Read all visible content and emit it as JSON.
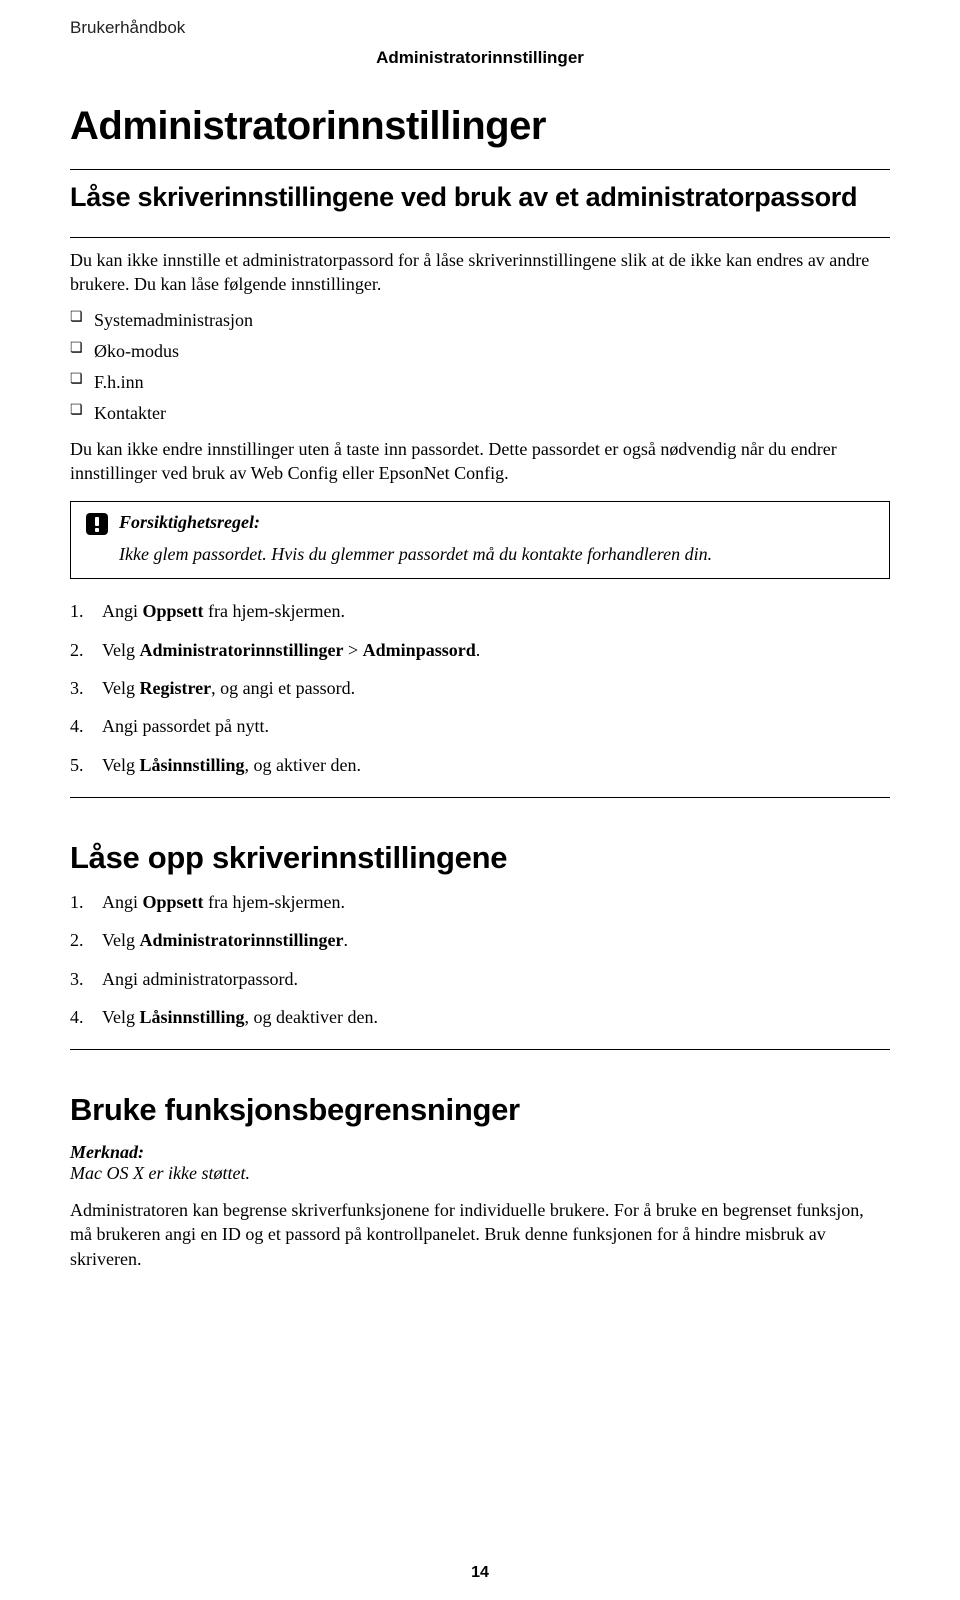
{
  "header": {
    "doc_label": "Brukerhåndbok",
    "section_label": "Administratorinnstillinger"
  },
  "title": "Administratorinnstillinger",
  "section1": {
    "heading": "Låse skriverinnstillingene ved bruk av et administratorpassord",
    "intro": "Du kan ikke innstille et administratorpassord for å låse skriverinnstillingene slik at de ikke kan endres av andre brukere. Du kan låse følgende innstillinger.",
    "bullets": [
      "Systemadministrasjon",
      "Øko-modus",
      "F.h.inn",
      "Kontakter"
    ],
    "after_bullets": "Du kan ikke endre innstillinger uten å taste inn passordet. Dette passordet er også nødvendig når du endrer innstillinger ved bruk av Web Config eller EpsonNet Config.",
    "caution": {
      "label": "Forsiktighetsregel:",
      "body": "Ikke glem passordet. Hvis du glemmer passordet må du kontakte forhandleren din."
    },
    "steps": [
      {
        "n": "1.",
        "pre": "Angi ",
        "b1": "Oppsett",
        "post": " fra hjem-skjermen."
      },
      {
        "n": "2.",
        "pre": "Velg ",
        "b1": "Administratorinnstillinger",
        "mid": " > ",
        "b2": "Adminpassord",
        "post": "."
      },
      {
        "n": "3.",
        "pre": "Velg ",
        "b1": "Registrer",
        "post": ", og angi et passord."
      },
      {
        "n": "4.",
        "pre": "Angi passordet på nytt.",
        "b1": "",
        "post": ""
      },
      {
        "n": "5.",
        "pre": "Velg ",
        "b1": "Låsinnstilling",
        "post": ", og aktiver den."
      }
    ]
  },
  "section2": {
    "heading": "Låse opp skriverinnstillingene",
    "steps": [
      {
        "n": "1.",
        "pre": "Angi ",
        "b1": "Oppsett",
        "post": " fra hjem-skjermen."
      },
      {
        "n": "2.",
        "pre": "Velg ",
        "b1": "Administratorinnstillinger",
        "post": "."
      },
      {
        "n": "3.",
        "pre": "Angi administratorpassord.",
        "b1": "",
        "post": ""
      },
      {
        "n": "4.",
        "pre": "Velg ",
        "b1": "Låsinnstilling",
        "post": ", og deaktiver den."
      }
    ]
  },
  "section3": {
    "heading": "Bruke funksjonsbegrensninger",
    "note_label": "Merknad:",
    "note_body": "Mac OS X er ikke støttet.",
    "body": "Administratoren kan begrense skriverfunksjonene for individuelle brukere. For å bruke en begrenset funksjon, må brukeren angi en ID og et passord på kontrollpanelet. Bruk denne funksjonen for å hindre misbruk av skriveren."
  },
  "page_number": "14"
}
